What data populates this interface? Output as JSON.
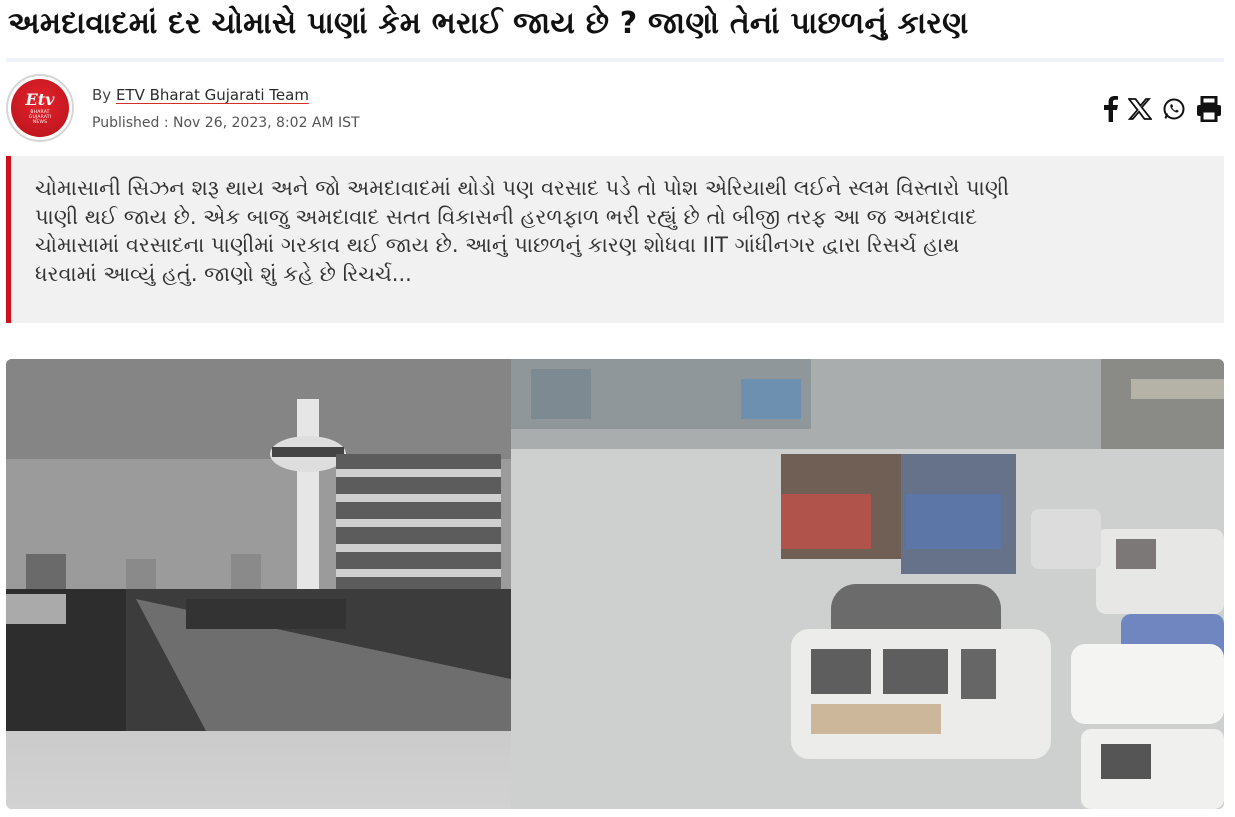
{
  "article": {
    "title": "અમદાવાદમાં દર ચોમાસે પાણાં કેમ ભરાઈ જાય છે ? જાણો તેનાં પાછળનું કારણ",
    "by_prefix": "By",
    "author": "ETV Bharat Gujarati Team",
    "published": "Published : Nov 26, 2023, 8:02 AM IST",
    "summary_lines": [
      "ચોમાસાની સિઝન શરૂ થાય અને જો અમદાવાદમાં થોડો પણ વરસાદ પડે તો પોશ એરિયાથી લઈને સ્લમ વિસ્તારો પાણી",
      "પાણી થઈ જાય છે. એક બાજુ અમદાવાદ સતત વિકાસની હરળફાળ ભરી રહ્યું છે તો બીજી તરફ આ જ અમદાવાદ",
      "ચોમાસામાં વરસાદના પાણીમાં ગરકાવ થઈ જાય છે. આનું પાછળનું કારણ શોધવા IIT ગાંધીનગર દ્વારા રિસર્ચ હાથ",
      "ધરવામાં આવ્યું હતું. જાણો શું કહે છે રિચર્ચ..."
    ]
  },
  "logo": {
    "mark": "Etv",
    "sub_lines": [
      "BHARAT",
      "GUJARATI",
      "NEWS"
    ]
  },
  "share_icons": [
    "facebook-icon",
    "x-icon",
    "whatsapp-icon",
    "print-icon"
  ],
  "colors": {
    "accent": "#d0111b",
    "summary_bg": "#f1f1f1"
  }
}
